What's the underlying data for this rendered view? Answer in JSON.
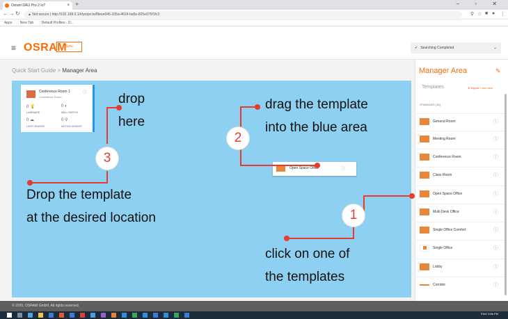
{
  "browser": {
    "tab_title": "Osram DALI Pro 2 IoT",
    "tab_close": "×",
    "new_tab": "+",
    "window_controls": "–  ▫  ✕",
    "url": "▲ Not secure | http://192.168.0.1/#/projects/f9eee045-335a-4624-ba5e-825e975f1fc3",
    "bookmarks": [
      "Apps",
      "New Tab",
      "Default Profiles - D..."
    ]
  },
  "header": {
    "logo": "OSRAM",
    "sync_label": "Sync",
    "search_status": "Searching Completed",
    "search_check": "✔",
    "dropdown_arrow": "⌄"
  },
  "breadcrumb": {
    "parent": "Quick Start Guide",
    "separator": " > ",
    "current": "Manager Area"
  },
  "room_card": {
    "title": "Conference Room 1",
    "subtitle": "Conference Room",
    "devices": [
      {
        "count": "0",
        "label": "LUMINAIRE"
      },
      {
        "count": "0",
        "label": "WALL SWITCH"
      },
      {
        "count": "0",
        "label": "LIGHT SENSOR"
      },
      {
        "count": "0",
        "label": "MOTION SENSOR"
      }
    ]
  },
  "instructions": {
    "drop_here_1": "drop",
    "drop_here_2": "here",
    "drag_1": "drag the template",
    "drag_2": "into the blue area",
    "drop_loc_1": "Drop the template",
    "drop_loc_2": "at the desired location",
    "click_1": "click on one of",
    "click_2": "the templates"
  },
  "badges": {
    "one": "1",
    "two": "2",
    "three": "3"
  },
  "dragged_template": {
    "label": "Open Space Office"
  },
  "sidebar": {
    "title": "Manager Area",
    "tab_templates": "Templates",
    "export_label": "Export",
    "export_extra": " / new view",
    "section": "STANDARD (16)",
    "templates": [
      "General Room",
      "Meeting Room",
      "Conference Room",
      "Class Room",
      "Open Space Office",
      "Multi Desk Office",
      "Single Office Comfort",
      "Single Office",
      "Lobby",
      "Corridor"
    ]
  },
  "footer": {
    "text": "© 2020, OSRAM GmbH. All rights reserved"
  },
  "taskbar": {
    "time": "3:56 PM",
    "lang": "ENG"
  },
  "colors": {
    "accent": "#ff6a00",
    "blue_area": "#8ed0f1",
    "marker_red": "#e53c2c"
  }
}
